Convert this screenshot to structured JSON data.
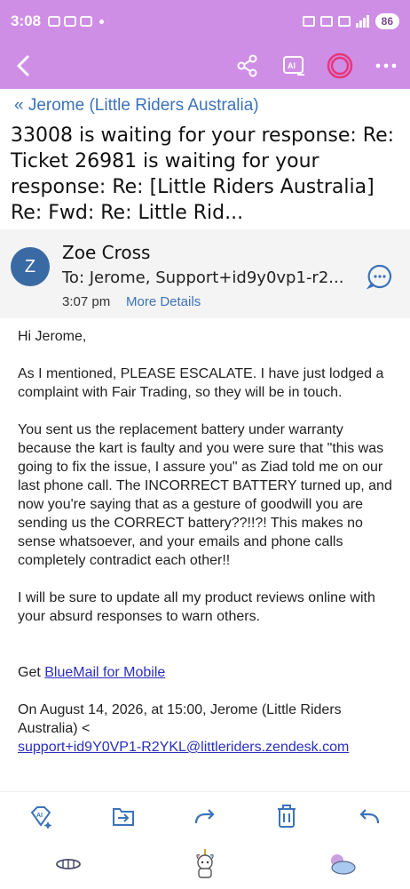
{
  "status_bar": {
    "time": "3:08",
    "battery": "86"
  },
  "colors": {
    "header_bg": "#cf8ee6",
    "link": "#3b73b9",
    "avatar": "#3a6aa4"
  },
  "header": {
    "breadcrumb": "« Jerome (Little Riders Australia)",
    "subject": "33008 is waiting for your response: Re: Ticket 26981 is waiting for your response: Re: [Little Riders Australia] Re: Fwd: Re: Little Rid..."
  },
  "sender": {
    "avatar_letter": "Z",
    "name": "Zoe Cross",
    "to": "To: Jerome, Support+id9y0vp1-r2...",
    "time": "3:07 pm",
    "more_details": "More Details"
  },
  "body": {
    "greeting": "Hi Jerome,",
    "p1": "As I mentioned, PLEASE ESCALATE. I have just lodged a complaint with Fair Trading, so they will be in touch.",
    "p2": "You sent us the replacement battery under warranty because the kart is faulty and you were sure that \"this was going to fix the issue, I assure you\" as Ziad told me on our last phone call. The INCORRECT BATTERY turned up, and now you're saying that as a gesture of goodwill you are sending us the CORRECT battery??!!?! This makes no sense whatsoever, and your emails and phone calls completely contradict each other!!",
    "p3": "I will be sure to update all my product reviews online with your absurd responses to warn others.",
    "get_prefix": "Get ",
    "get_link": "BlueMail for Mobile",
    "quote_intro": "On August 14, 2026, at 15:00, Jerome (Little Riders Australia) <",
    "quote_email": "support+id9Y0VP1-R2YKL@littleriders.zendesk.com"
  },
  "icons": {
    "toolbar": [
      "back-arrow-icon",
      "share-icon",
      "ai-assistant-icon",
      "circle-ring-icon",
      "more-icon"
    ],
    "actions": [
      "ai-sparkle-icon",
      "move-to-icon",
      "forward-icon",
      "delete-icon",
      "reply-icon"
    ],
    "nav": [
      "shell-icon",
      "unicorn-icon",
      "cloud-icon"
    ]
  }
}
